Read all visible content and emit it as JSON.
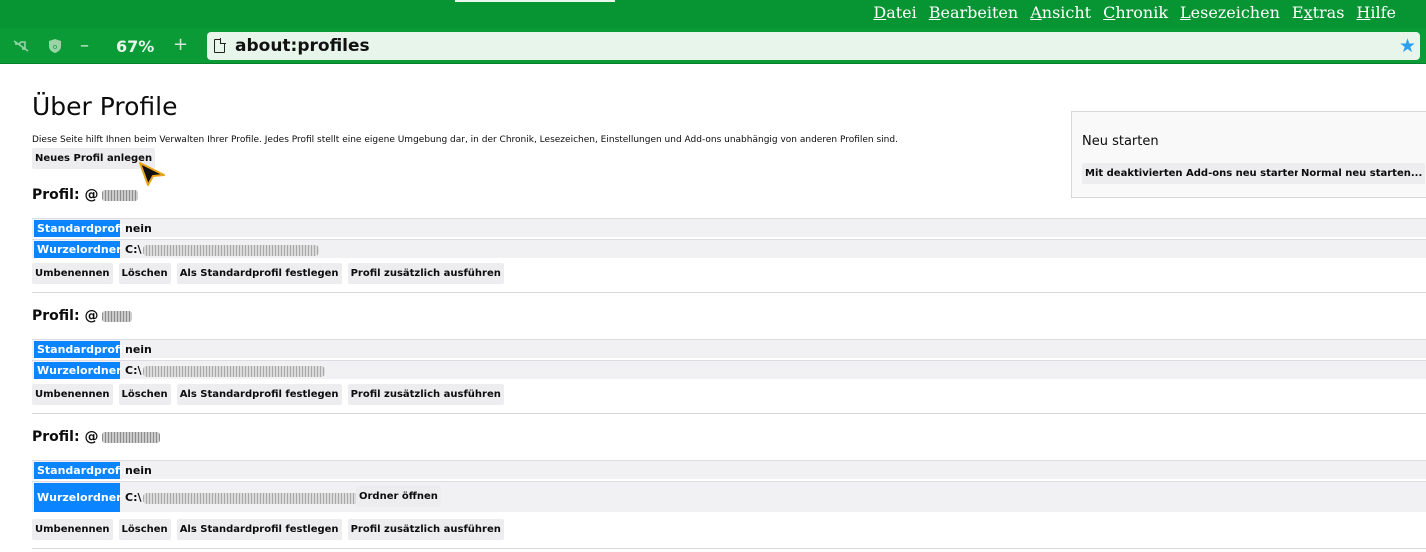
{
  "menu": [
    {
      "acc": "D",
      "rest": "atei"
    },
    {
      "acc": "B",
      "rest": "earbeiten"
    },
    {
      "acc": "A",
      "rest": "nsicht"
    },
    {
      "acc": "C",
      "rest": "hronik"
    },
    {
      "acc": "L",
      "rest": "esezeichen"
    },
    {
      "pre": "E",
      "acc": "x",
      "rest": "tras"
    },
    {
      "acc": "H",
      "rest": "ilfe"
    }
  ],
  "toolbar": {
    "zoom_out": "–",
    "zoom_level": "67%",
    "zoom_in": "+",
    "url": "about:profiles"
  },
  "page": {
    "title": "Über Profile",
    "intro": "Diese Seite hilft Ihnen beim Verwalten Ihrer Profile. Jedes Profil stellt eine eigene Umgebung dar, in der Chronik, Lesezeichen, Einstellungen und Add-ons unabhängig von anderen Profilen sind.",
    "new_profile_button": "Neues Profil anlegen"
  },
  "restart": {
    "title": "Neu starten",
    "safe_mode_button": "Mit deaktivierten Add-ons neu starten...",
    "normal_button": "Normal neu starten..."
  },
  "labels": {
    "profile_prefix": "Profil:",
    "default_profile": "Standardprofil",
    "root_folder": "Wurzelordner",
    "rename": "Umbenennen",
    "delete": "Löschen",
    "set_default": "Als Standardprofil festlegen",
    "launch": "Profil zusätzlich ausführen",
    "open_folder": "Ordner öffnen"
  },
  "profiles": [
    {
      "name_visible": "@",
      "default_value": "nein",
      "root_prefix": "C:\\"
    },
    {
      "name_visible": "@",
      "default_value": "nein",
      "root_prefix": "C:\\"
    },
    {
      "name_visible": "@",
      "default_value": "nein",
      "root_prefix": "C:\\"
    }
  ]
}
